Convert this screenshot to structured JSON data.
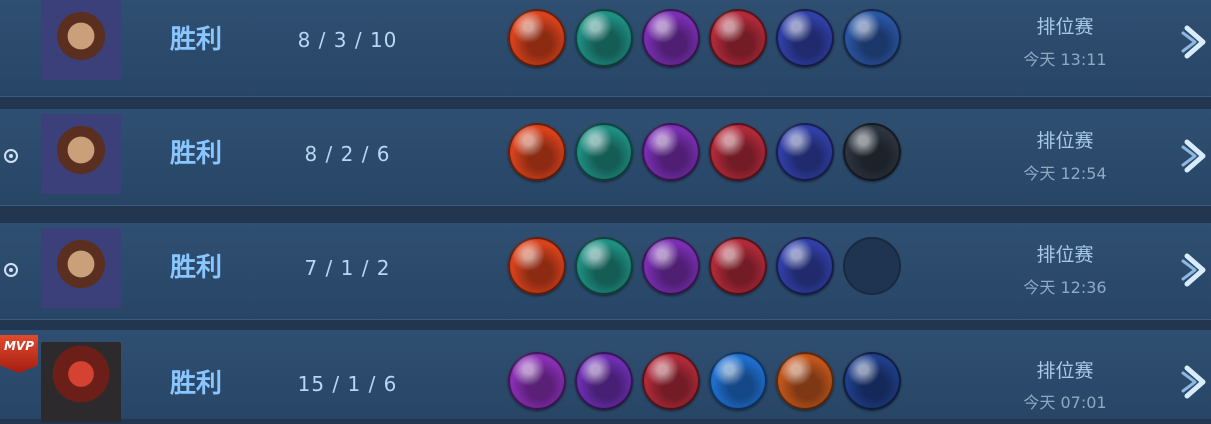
{
  "matches": [
    {
      "result": "胜利",
      "kda": "8 / 3 / 10",
      "mode": "排位赛",
      "time": "今天 13:11",
      "mvp": false,
      "mode_icon": false,
      "avatar": "hero-avatar-a",
      "items": [
        "#d9421c",
        "#1f8f83",
        "#7a2fb2",
        "#b12a3a",
        "#3140a8",
        "#2a55a3"
      ]
    },
    {
      "result": "胜利",
      "kda": "8 / 2 / 6",
      "mode": "排位赛",
      "time": "今天 12:54",
      "mvp": false,
      "mode_icon": true,
      "avatar": "hero-avatar-a",
      "items": [
        "#d9421c",
        "#1f8f83",
        "#7a2fb2",
        "#b12a3a",
        "#3140a8",
        "#2c3440"
      ]
    },
    {
      "result": "胜利",
      "kda": "7 / 1 / 2",
      "mode": "排位赛",
      "time": "今天 12:36",
      "mvp": false,
      "mode_icon": true,
      "avatar": "hero-avatar-a",
      "items": [
        "#d9421c",
        "#1f8f83",
        "#7a2fb2",
        "#b12a3a",
        "#3140a8",
        ""
      ]
    },
    {
      "result": "胜利",
      "kda": "15 / 1 / 6",
      "mode": "排位赛",
      "time": "今天 07:01",
      "mvp": true,
      "mvp_label": "MVP",
      "mode_icon": false,
      "avatar": "hero-avatar-b",
      "items": [
        "#8a2fb6",
        "#6d2fb2",
        "#b12a3a",
        "#1f6fd0",
        "#c2561d",
        "#1f3f8a"
      ]
    }
  ],
  "colors": {
    "result_text": "#89c6ff",
    "row_bg": "#2f4f72",
    "page_bg": "#22364f"
  }
}
